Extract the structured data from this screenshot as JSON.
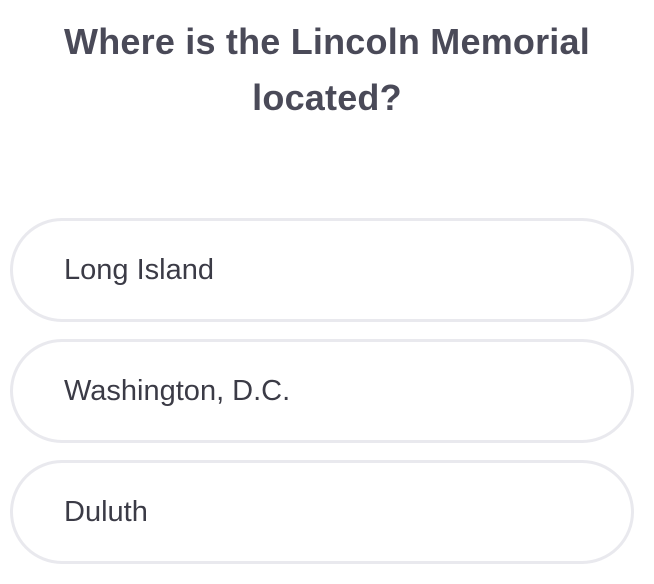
{
  "question": {
    "text": "Where is the Lincoln Memorial located?"
  },
  "options": [
    {
      "label": "Long Island"
    },
    {
      "label": "Washington, D.C."
    },
    {
      "label": "Duluth"
    }
  ],
  "colors": {
    "question_text": "#4a4a58",
    "option_text": "#3b3b46",
    "option_border": "#e9e9ee",
    "background": "#ffffff"
  }
}
